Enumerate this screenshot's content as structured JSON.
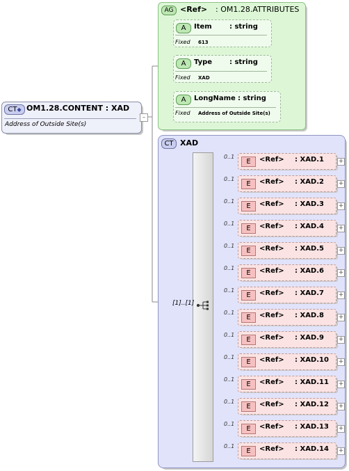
{
  "root": {
    "badge": "CT",
    "title": "OM1.28.CONTENT : XAD",
    "annotation": "Address of Outside Site(s)",
    "expander": "–"
  },
  "attribute_group": {
    "badge": "AG",
    "ref": "<Ref>",
    "title": ": OM1.28.ATTRIBUTES",
    "attributes": [
      {
        "badge": "A",
        "name": "Item",
        "type": ": string",
        "fixed_label": "Fixed",
        "fixed_value": "613"
      },
      {
        "badge": "A",
        "name": "Type",
        "type": ": string",
        "fixed_label": "Fixed",
        "fixed_value": "XAD"
      },
      {
        "badge": "A",
        "name": "LongName",
        "type": ": string",
        "fixed_label": "Fixed",
        "fixed_value": "Address of Outside Site(s)"
      }
    ]
  },
  "xad": {
    "badge": "CT",
    "title": "XAD",
    "sequence_cardinality": "[1]..[1]",
    "elements": [
      {
        "card": "0..1",
        "badge": "E",
        "ref": "<Ref>",
        "name": ": XAD.1"
      },
      {
        "card": "0..1",
        "badge": "E",
        "ref": "<Ref>",
        "name": ": XAD.2"
      },
      {
        "card": "0..1",
        "badge": "E",
        "ref": "<Ref>",
        "name": ": XAD.3"
      },
      {
        "card": "0..1",
        "badge": "E",
        "ref": "<Ref>",
        "name": ": XAD.4"
      },
      {
        "card": "0..1",
        "badge": "E",
        "ref": "<Ref>",
        "name": ": XAD.5"
      },
      {
        "card": "0..1",
        "badge": "E",
        "ref": "<Ref>",
        "name": ": XAD.6"
      },
      {
        "card": "0..1",
        "badge": "E",
        "ref": "<Ref>",
        "name": ": XAD.7"
      },
      {
        "card": "0..1",
        "badge": "E",
        "ref": "<Ref>",
        "name": ": XAD.8"
      },
      {
        "card": "0..1",
        "badge": "E",
        "ref": "<Ref>",
        "name": ": XAD.9"
      },
      {
        "card": "0..1",
        "badge": "E",
        "ref": "<Ref>",
        "name": ": XAD.10"
      },
      {
        "card": "0..1",
        "badge": "E",
        "ref": "<Ref>",
        "name": ": XAD.11"
      },
      {
        "card": "0..1",
        "badge": "E",
        "ref": "<Ref>",
        "name": ": XAD.12"
      },
      {
        "card": "0..1",
        "badge": "E",
        "ref": "<Ref>",
        "name": ": XAD.13"
      },
      {
        "card": "0..1",
        "badge": "E",
        "ref": "<Ref>",
        "name": ": XAD.14"
      }
    ],
    "expand_symbol": "+"
  }
}
